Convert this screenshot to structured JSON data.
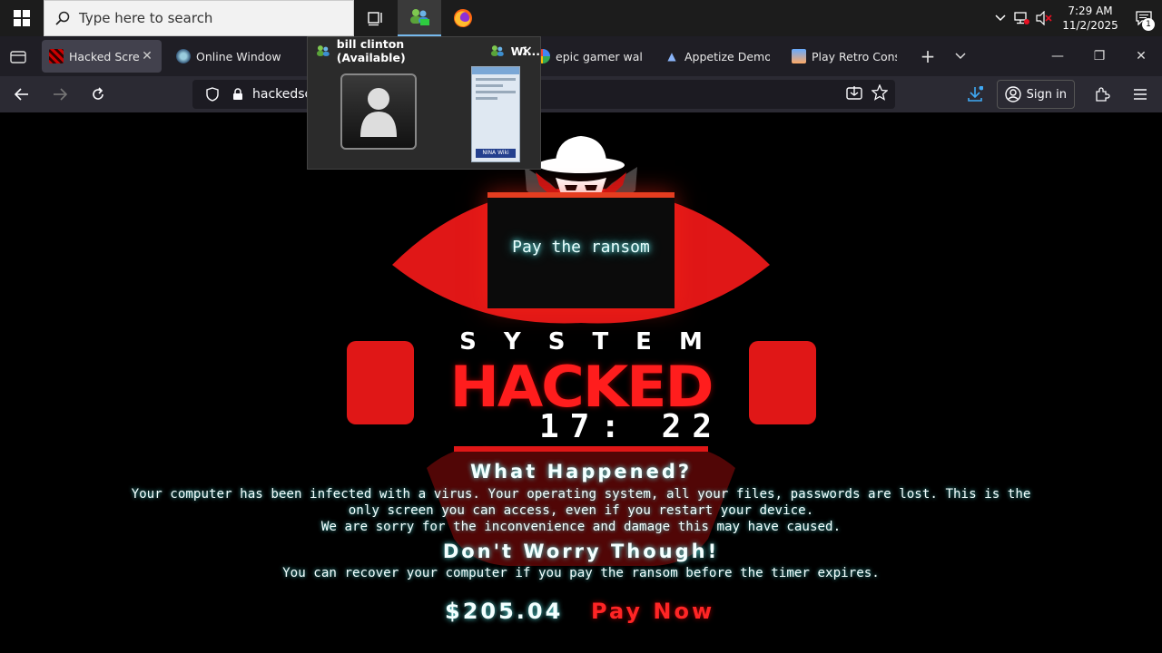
{
  "taskbar": {
    "search_placeholder": "Type here to search",
    "clock_time": "7:29 AM",
    "clock_date": "11/2/2025",
    "notification_count": "1"
  },
  "browser": {
    "tabs": [
      {
        "label": "Hacked Screen",
        "favicon": "red-grid-icon",
        "selected": true
      },
      {
        "label": "Online Windows X",
        "favicon": "globe-icon",
        "selected": false
      },
      {
        "label": "epic gamer wallpa",
        "favicon": "google-icon",
        "selected": false
      },
      {
        "label": "Appetize Demo",
        "favicon": "appetize-icon",
        "selected": false
      },
      {
        "label": "Play Retro Console",
        "favicon": "retro-icon",
        "selected": false
      }
    ],
    "url": "hackedscre",
    "sign_in_label": "Sign in"
  },
  "preview": {
    "contact_title": "bill clinton (Available)",
    "window_title": "Wi...",
    "thumb_footer": "NINA Wiki"
  },
  "ransom": {
    "box_label": "Pay the ransom",
    "system_label": "SYSTEM",
    "hacked_label": "HACKED",
    "timer": "17: 22",
    "what_heading": "What Happened?",
    "desc_line1": "Your computer has been infected with a virus. Your operating system, all your files, passwords are lost. This is the",
    "desc_line2": "only screen you can access, even if you restart your device.",
    "desc_line3": "We are sorry for the inconvenience and damage this may have caused.",
    "dont_heading": "Don't Worry Though!",
    "recover_text": "You can recover your computer if you pay the ransom before the timer expires.",
    "price": "$205.04",
    "pay_now_label": "Pay Now"
  },
  "colors": {
    "accent_red": "#e01717",
    "glow_cyan": "#5dd",
    "tab_selected": "#42414d",
    "toolbar": "#2b2a33"
  }
}
